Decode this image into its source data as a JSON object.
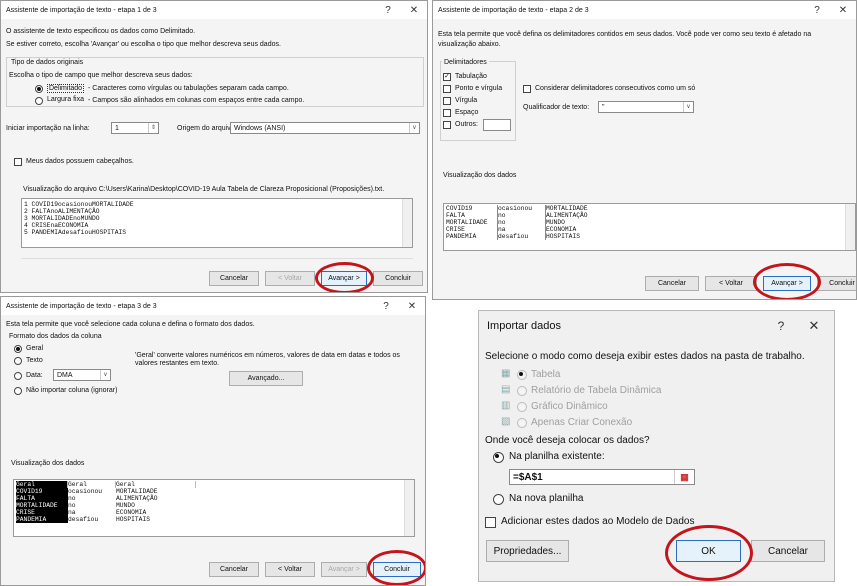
{
  "d1": {
    "title": "Assistente de importação de texto - etapa 1 de 3",
    "help": "?",
    "close": "✕",
    "l1": "O assistente de texto especificou os dados como Delimitado.",
    "l2": "Se estiver correto, escolha 'Avançar' ou escolha o tipo que melhor descreva seus dados.",
    "grp_title": "Tipo de dados originais",
    "grp_sub": "Escolha o tipo de campo que melhor descreva seus dados:",
    "r1": "Delimitado",
    "r1d": "- Caracteres como vírgulas ou tabulações separam cada campo.",
    "r2": "Largura fixa",
    "r2d": "- Campos são alinhados em colunas com espaços entre cada campo.",
    "start_label": "Iniciar importação na linha:",
    "start_value": "1",
    "origin_label": "Origem do arquivo:",
    "origin_value": "Windows (ANSI)",
    "headers_label": "Meus dados possuem cabeçalhos.",
    "preview_label": "Visualização do arquivo C:\\Users\\Karina\\Desktop\\COVID-19 Aula Tabela de Clareza Proposicional (Proposições).txt.",
    "preview_rows": [
      "1 COVID19ocasionouMORTALIDADE",
      "2 FALTAnoALIMENTAÇÃO",
      "3 MORTALIDADEnoMUNDO",
      "4 CRISEnaECONOMIA",
      "5 PANDEMIAdesafiouHOSPITAIS"
    ],
    "btn_cancel": "Cancelar",
    "btn_back": "< Voltar",
    "btn_next": "Avançar >",
    "btn_finish": "Concluir"
  },
  "d2": {
    "title": "Assistente de importação de texto - etapa 2 de 3",
    "help": "?",
    "close": "✕",
    "l1": "Esta tela permite que você defina os delimitadores contidos em seus dados. Você pode ver como seu texto é afetado na",
    "l2": "visualização abaixo.",
    "grp_title": "Delimitadores",
    "delims": [
      "Tabulação",
      "Ponto e vírgula",
      "Vírgula",
      "Espaço",
      "Outros:"
    ],
    "delims_checked": [
      true,
      false,
      false,
      false,
      false
    ],
    "consec_label": "Considerar delimitadores consecutivos como um só",
    "qual_label": "Qualificador de texto:",
    "qual_value": "\"",
    "preview_label": "Visualização dos dados",
    "preview_rows": [
      [
        "COVID19",
        "ocasionou",
        "MORTALIDADE"
      ],
      [
        "FALTA",
        "no",
        "ALIMENTAÇÃO"
      ],
      [
        "MORTALIDADE",
        "no",
        "MUNDO"
      ],
      [
        "CRISE",
        "na",
        "ECONOMIA"
      ],
      [
        "PANDEMIA",
        "desafiou",
        "HOSPITAIS"
      ]
    ],
    "btn_cancel": "Cancelar",
    "btn_back": "< Voltar",
    "btn_next": "Avançar >",
    "btn_finish": "Concluir"
  },
  "d3": {
    "title": "Assistente de importação de texto - etapa 3 de 3",
    "help": "?",
    "close": "✕",
    "l1": "Esta tela permite que você selecione cada coluna e defina o formato dos dados.",
    "grp_title": "Formato dos dados da coluna",
    "r_geral": "Geral",
    "r_texto": "Texto",
    "r_data": "Data:",
    "data_value": "DMA",
    "r_skip": "Não importar coluna (ignorar)",
    "desc": "'Geral' converte valores numéricos em números, valores de data em datas e todos os valores restantes em texto.",
    "btn_adv": "Avançado...",
    "preview_label": "Visualização dos dados",
    "headers": [
      "Geral",
      "Geral",
      "Geral"
    ],
    "preview_rows": [
      [
        "COVID19",
        "ocasionou",
        "MORTALIDADE"
      ],
      [
        "FALTA",
        "no",
        "ALIMENTAÇÃO"
      ],
      [
        "MORTALIDADE",
        "no",
        "MUNDO"
      ],
      [
        "CRISE",
        "na",
        "ECONOMIA"
      ],
      [
        "PANDEMIA",
        "desafiou",
        "HOSPITAIS"
      ]
    ],
    "btn_cancel": "Cancelar",
    "btn_back": "< Voltar",
    "btn_next": "Avançar >",
    "btn_finish": "Concluir"
  },
  "d4": {
    "title": "Importar dados",
    "help": "?",
    "close": "✕",
    "q1": "Selecione o modo como deseja exibir estes dados na pasta de trabalho.",
    "opts": [
      "Tabela",
      "Relatório de Tabela Dinâmica",
      "Gráfico Dinâmico",
      "Apenas Criar Conexão"
    ],
    "q2": "Onde você deseja colocar os dados?",
    "r_exist": "Na planilha existente:",
    "ref": "=$A$1",
    "r_new": "Na nova planilha",
    "model_label": "Adicionar estes dados ao Modelo de Dados",
    "btn_props": "Propriedades...",
    "btn_ok": "OK",
    "btn_cancel": "Cancelar"
  }
}
